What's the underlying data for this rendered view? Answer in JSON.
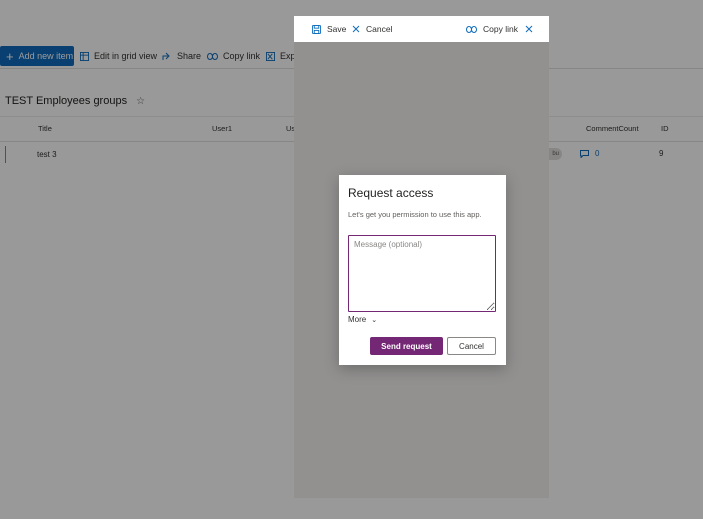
{
  "commandbar": {
    "new_item": "Add new item",
    "edit_grid": "Edit in grid view",
    "share": "Share",
    "copy_link": "Copy link",
    "export": "Expo"
  },
  "list": {
    "title": "TEST Employees groups",
    "star": "☆",
    "columns": [
      "Title",
      "User1",
      "Us",
      "CommentCount",
      "ID"
    ],
    "row": {
      "title": "test 3",
      "pill": "bu",
      "comment_count": "0",
      "id": "9"
    }
  },
  "panel": {
    "save": "Save",
    "cancel": "Cancel",
    "copy_link": "Copy link"
  },
  "dialog": {
    "title": "Request access",
    "subtitle": "Let's get you permission to use this app.",
    "message_placeholder": "Message (optional)",
    "more": "More",
    "send": "Send request",
    "cancel": "Cancel"
  },
  "colors": {
    "brand_blue": "#0f6cbd",
    "accent_purple": "#742774",
    "overlay": "rgba(0,0,0,0.40)"
  }
}
